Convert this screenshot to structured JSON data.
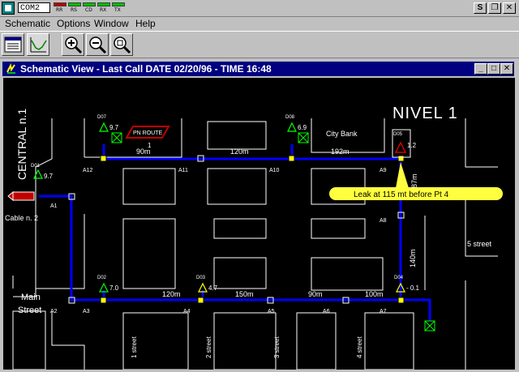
{
  "app": {
    "port": "COM2",
    "led_labels": [
      "RR",
      "RS",
      "CD",
      "RX",
      "TX"
    ]
  },
  "menu": [
    "Schematic",
    "Options",
    "Window",
    "Help"
  ],
  "window": {
    "title": "Schematic View - Last Call DATE 02/20/96 - TIME 16:48"
  },
  "map": {
    "level": "NIVEL   1",
    "central": "CENTRAL n.1",
    "cable": "Cable n. 2",
    "city_bank": "City Bank",
    "pn_route": "PN ROUTE",
    "pn_route_num": "1",
    "leak": "Leak at 115 mt before Pt 4",
    "main_street": [
      "Main",
      "Street"
    ],
    "streets": [
      "1 street",
      "2 street",
      "3 street",
      "4 street",
      "5 street"
    ],
    "sensors": [
      {
        "id": "D01",
        "value": "9.7"
      },
      {
        "id": "D07",
        "value": "9.7"
      },
      {
        "id": "D08",
        "value": "6.9"
      },
      {
        "id": "D05",
        "value": "1.2"
      },
      {
        "id": "D02",
        "value": "7.0"
      },
      {
        "id": "D03",
        "value": "4.7"
      },
      {
        "id": "D04",
        "value": "- 0.1"
      }
    ],
    "nodes": [
      "A1",
      "A2",
      "A3",
      "A4",
      "A5",
      "A6",
      "A7",
      "A8",
      "A9",
      "A10",
      "A11",
      "A12"
    ],
    "distances": [
      "90m",
      "120m",
      "192m",
      "87m",
      "140m",
      "120m",
      "150m",
      "90m",
      "100m"
    ]
  }
}
